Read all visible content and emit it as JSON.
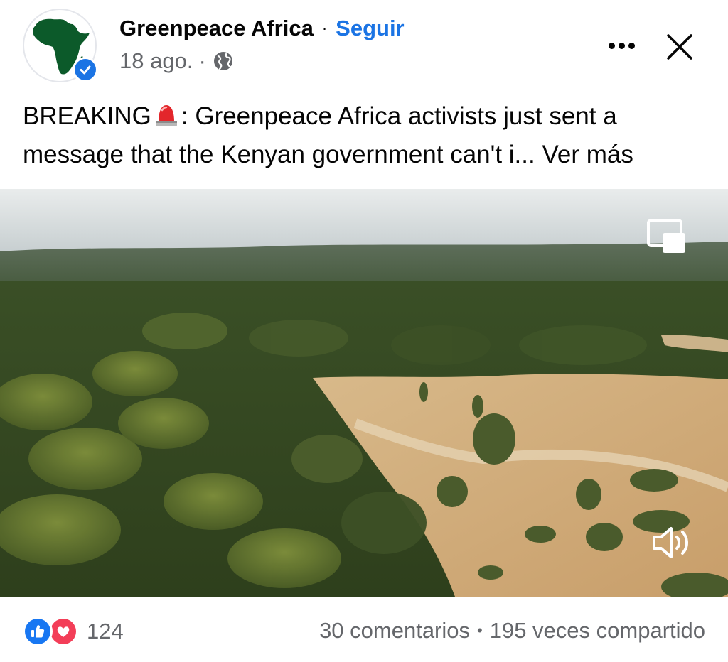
{
  "post": {
    "author": "Greenpeace Africa",
    "separator": "·",
    "follow_label": "Seguir",
    "date": "18 ago.",
    "date_separator": "·",
    "privacy_icon": "globe-icon",
    "text_before_emoji": "BREAKING",
    "emoji": "rotating-light-icon",
    "text_after_emoji": ": Greenpeace Africa activists just sent a message that the Kenyan government can't i...",
    "see_more_label": "Ver más"
  },
  "media": {
    "type": "video",
    "pip_icon": "picture-in-picture-icon",
    "sound_icon": "speaker-icon"
  },
  "footer": {
    "reaction_icons": [
      "like-icon",
      "love-icon"
    ],
    "reaction_count": "124",
    "comments": "30 comentarios",
    "stats_separator": "•",
    "shares": "195 veces compartido"
  },
  "colors": {
    "brand_blue": "#1b74e4",
    "muted_text": "#65676b",
    "logo_green": "#0c5a2a",
    "like_blue": "#1877f2",
    "love_red": "#f33e58"
  }
}
